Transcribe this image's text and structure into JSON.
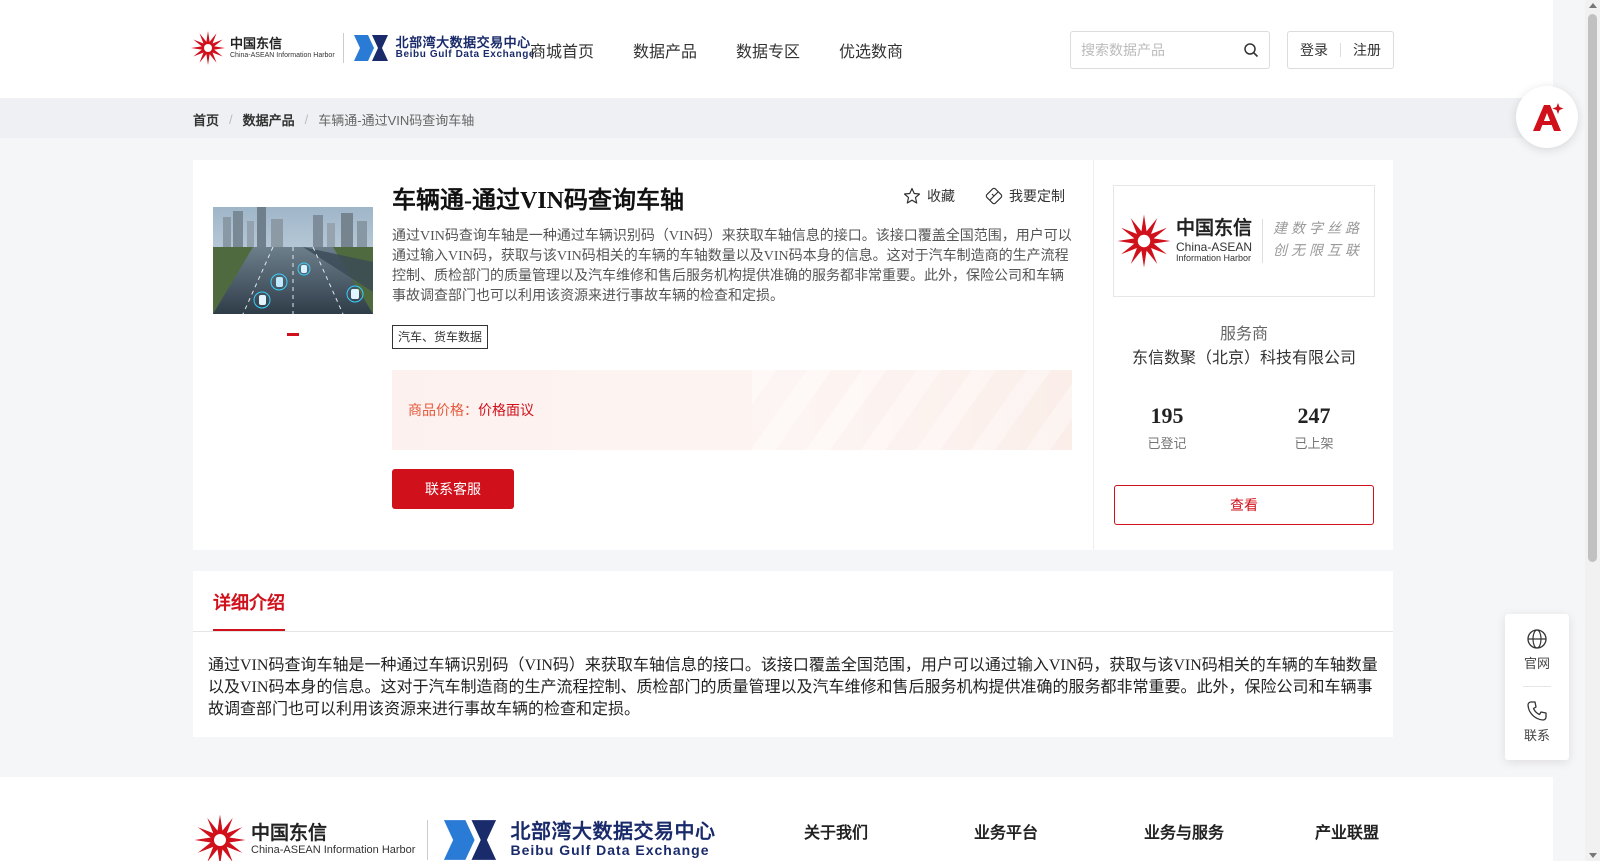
{
  "header": {
    "logo": {
      "ct_cn": "中国东信",
      "ct_en": "China-ASEAN Information Harbor",
      "bg_cn": "北部湾大数据交易中心",
      "bg_en": "Beibu Gulf Data Exchange"
    },
    "nav": [
      "商城首页",
      "数据产品",
      "数据专区",
      "优选数商"
    ],
    "search": {
      "placeholder": "搜索数据产品",
      "value": ""
    },
    "login": "登录",
    "register": "注册"
  },
  "breadcrumb": [
    "首页",
    "数据产品",
    "车辆通-通过VIN码查询车轴"
  ],
  "product": {
    "title": "车辆通-通过VIN码查询车轴",
    "favorite": "收藏",
    "customize": "我要定制",
    "description": "通过VIN码查询车轴是一种通过车辆识别码（VIN码）来获取车轴信息的接口。该接口覆盖全国范围，用户可以通过输入VIN码，获取与该VIN码相关的车辆的车轴数量以及VIN码本身的信息。这对于汽车制造商的生产流程控制、质检部门的质量管理以及汽车维修和售后服务机构提供准确的服务都非常重要。此外，保险公司和车辆事故调查部门也可以利用该资源来进行事故车辆的检查和定损。",
    "tag": "汽车、货车数据",
    "price_label": "商品价格：",
    "price_value": "价格面议",
    "contact_button": "联系客服"
  },
  "provider": {
    "logo_cn": "中国东信",
    "logo_en1": "China-ASEAN",
    "logo_en2": "Information Harbor",
    "slogan1": "建数字丝路",
    "slogan2": "创无限互联",
    "label": "服务商",
    "name": "东信数聚（北京）科技有限公司",
    "registered_count": "195",
    "registered_label": "已登记",
    "listed_count": "247",
    "listed_label": "已上架",
    "view_button": "查看"
  },
  "detail": {
    "tab": "详细介绍",
    "text": "通过VIN码查询车轴是一种通过车辆识别码（VIN码）来获取车轴信息的接口。该接口覆盖全国范围，用户可以通过输入VIN码，获取与该VIN码相关的车辆的车轴数量以及VIN码本身的信息。这对于汽车制造商的生产流程控制、质检部门的质量管理以及汽车维修和售后服务机构提供准确的服务都非常重要。此外，保险公司和车辆事故调查部门也可以利用该资源来进行事故车辆的检查和定损。"
  },
  "footer": {
    "logo": {
      "ct_cn": "中国东信",
      "ct_en": "China-ASEAN Information Harbor",
      "bg_cn": "北部湾大数据交易中心",
      "bg_en": "Beibu Gulf Data Exchange"
    },
    "nav": [
      "关于我们",
      "业务平台",
      "业务与服务",
      "产业联盟"
    ]
  },
  "sidebar": {
    "website": "官网",
    "contact": "联系"
  },
  "colors": {
    "brand_red": "#d0101b",
    "brand_blue": "#1a2b6b",
    "price_orange": "#e55a3c"
  },
  "icons": [
    "search-icon",
    "star-icon",
    "customize-icon",
    "globe-icon",
    "phone-icon",
    "ai-assistant-icon"
  ]
}
